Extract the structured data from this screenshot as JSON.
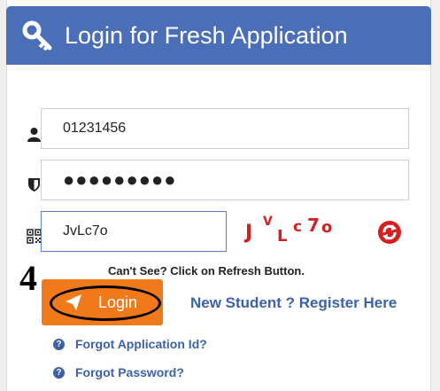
{
  "header": {
    "title": "Login for Fresh Application",
    "icon": "key-icon"
  },
  "form": {
    "application_id": {
      "value": "01231456",
      "icon": "user-icon"
    },
    "password": {
      "value": "●●●●●●●●●",
      "icon": "shield-icon"
    },
    "captcha_input": {
      "value": "JvLc7o",
      "icon": "qrcode-icon"
    },
    "captcha_image": {
      "chars": [
        "J",
        "V",
        "L",
        "c",
        "7",
        "o"
      ]
    },
    "refresh_icon": "refresh-icon"
  },
  "step_number": "4",
  "hint_text": "Can't See? Click on Refresh Button.",
  "login_button": {
    "label": "Login",
    "icon": "paper-plane-icon",
    "color": "#f07a1a"
  },
  "register_link": "New Student ? Register Here",
  "help_links": [
    {
      "label": "Forgot Application Id?",
      "icon": "question-icon"
    },
    {
      "label": "Forgot Password?",
      "icon": "question-icon"
    }
  ],
  "colors": {
    "header": "#4a6fb8",
    "link": "#3b62a8",
    "captcha": "#d42020"
  }
}
